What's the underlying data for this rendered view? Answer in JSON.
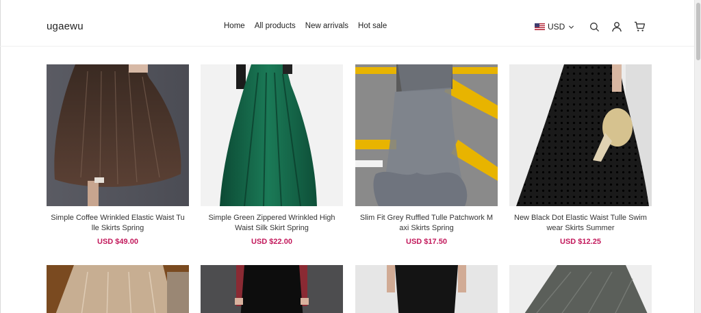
{
  "header": {
    "logo": "ugaewu",
    "nav": [
      "Home",
      "All products",
      "New arrivals",
      "Hot sale"
    ],
    "currency": "USD",
    "icons": [
      "search-icon",
      "account-icon",
      "cart-icon"
    ]
  },
  "colors": {
    "price": "#c2185b",
    "text": "#222222",
    "background": "#ffffff"
  },
  "products": [
    {
      "title": "Simple Coffee Wrinkled Elastic Waist Tulle Skirts Spring",
      "price": "USD $49.00"
    },
    {
      "title": "Simple Green Zippered Wrinkled High Waist Silk Skirt Spring",
      "price": "USD $22.00"
    },
    {
      "title": "Slim Fit Grey Ruffled Tulle Patchwork Maxi Skirts Spring",
      "price": "USD $17.50"
    },
    {
      "title": "New Black Dot Elastic Waist Tulle Swimwear Skirts Summer",
      "price": "USD $12.25"
    }
  ]
}
